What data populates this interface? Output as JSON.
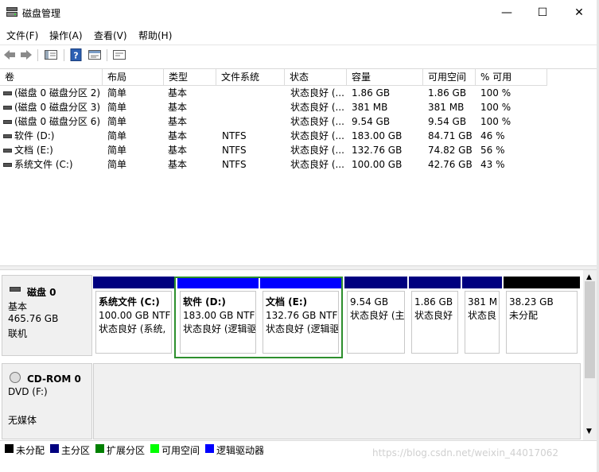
{
  "window": {
    "title": "磁盘管理",
    "minimize": "—",
    "maximize": "☐",
    "close": "✕"
  },
  "menu": {
    "file": "文件(F)",
    "action": "操作(A)",
    "view": "查看(V)",
    "help": "帮助(H)"
  },
  "toolbar": {
    "icons": [
      "back-arrow-icon",
      "forward-arrow-icon",
      "console-tree-icon",
      "help-icon",
      "properties-icon",
      "disk-list-icon"
    ]
  },
  "volume_list": {
    "columns": [
      "卷",
      "布局",
      "类型",
      "文件系统",
      "状态",
      "容量",
      "可用空间",
      "% 可用"
    ],
    "rows": [
      {
        "volume": "(磁盘 0 磁盘分区 2)",
        "layout": "简单",
        "type": "基本",
        "fs": "",
        "status": "状态良好 (...",
        "capacity": "1.86 GB",
        "free": "1.86 GB",
        "pct": "100 %"
      },
      {
        "volume": "(磁盘 0 磁盘分区 3)",
        "layout": "简单",
        "type": "基本",
        "fs": "",
        "status": "状态良好 (...",
        "capacity": "381 MB",
        "free": "381 MB",
        "pct": "100 %"
      },
      {
        "volume": "(磁盘 0 磁盘分区 6)",
        "layout": "简单",
        "type": "基本",
        "fs": "",
        "status": "状态良好 (...",
        "capacity": "9.54 GB",
        "free": "9.54 GB",
        "pct": "100 %"
      },
      {
        "volume": "软件 (D:)",
        "layout": "简单",
        "type": "基本",
        "fs": "NTFS",
        "status": "状态良好 (...",
        "capacity": "183.00 GB",
        "free": "84.71 GB",
        "pct": "46 %"
      },
      {
        "volume": "文档 (E:)",
        "layout": "简单",
        "type": "基本",
        "fs": "NTFS",
        "status": "状态良好 (...",
        "capacity": "132.76 GB",
        "free": "74.82 GB",
        "pct": "56 %"
      },
      {
        "volume": "系统文件 (C:)",
        "layout": "简单",
        "type": "基本",
        "fs": "NTFS",
        "status": "状态良好 (...",
        "capacity": "100.00 GB",
        "free": "42.76 GB",
        "pct": "43 %"
      }
    ]
  },
  "disk0": {
    "name": "磁盘 0",
    "kind": "基本",
    "size": "465.76 GB",
    "state": "联机",
    "partitions": [
      {
        "name": "系统文件 (C:)",
        "size": "100.00 GB NTFS",
        "status": "状态良好 (系统,",
        "color": "#00007f"
      },
      {
        "name": "软件 (D:)",
        "size": "183.00 GB NTFS",
        "status": "状态良好 (逻辑驱",
        "color": "#0000ff"
      },
      {
        "name": "文档 (E:)",
        "size": "132.76 GB NTFS",
        "status": "状态良好 (逻辑驱",
        "color": "#0000ff"
      },
      {
        "name": "",
        "size": "9.54 GB",
        "status": "状态良好 (主",
        "color": "#00007f"
      },
      {
        "name": "",
        "size": "1.86 GB",
        "status": "状态良好",
        "color": "#00007f"
      },
      {
        "name": "",
        "size": "381 M",
        "status": "状态良",
        "color": "#00007f"
      },
      {
        "name": "",
        "size": "38.23 GB",
        "status": "未分配",
        "color": "#000000"
      }
    ]
  },
  "cdrom0": {
    "name": "CD-ROM 0",
    "drive": "DVD (F:)",
    "media": "无媒体"
  },
  "legend": [
    {
      "label": "未分配",
      "color": "#000000"
    },
    {
      "label": "主分区",
      "color": "#00007f"
    },
    {
      "label": "扩展分区",
      "color": "#008000"
    },
    {
      "label": "可用空间",
      "color": "#00ff00"
    },
    {
      "label": "逻辑驱动器",
      "color": "#0000ff"
    }
  ],
  "watermark": "https://blog.csdn.net/weixin_44017062"
}
